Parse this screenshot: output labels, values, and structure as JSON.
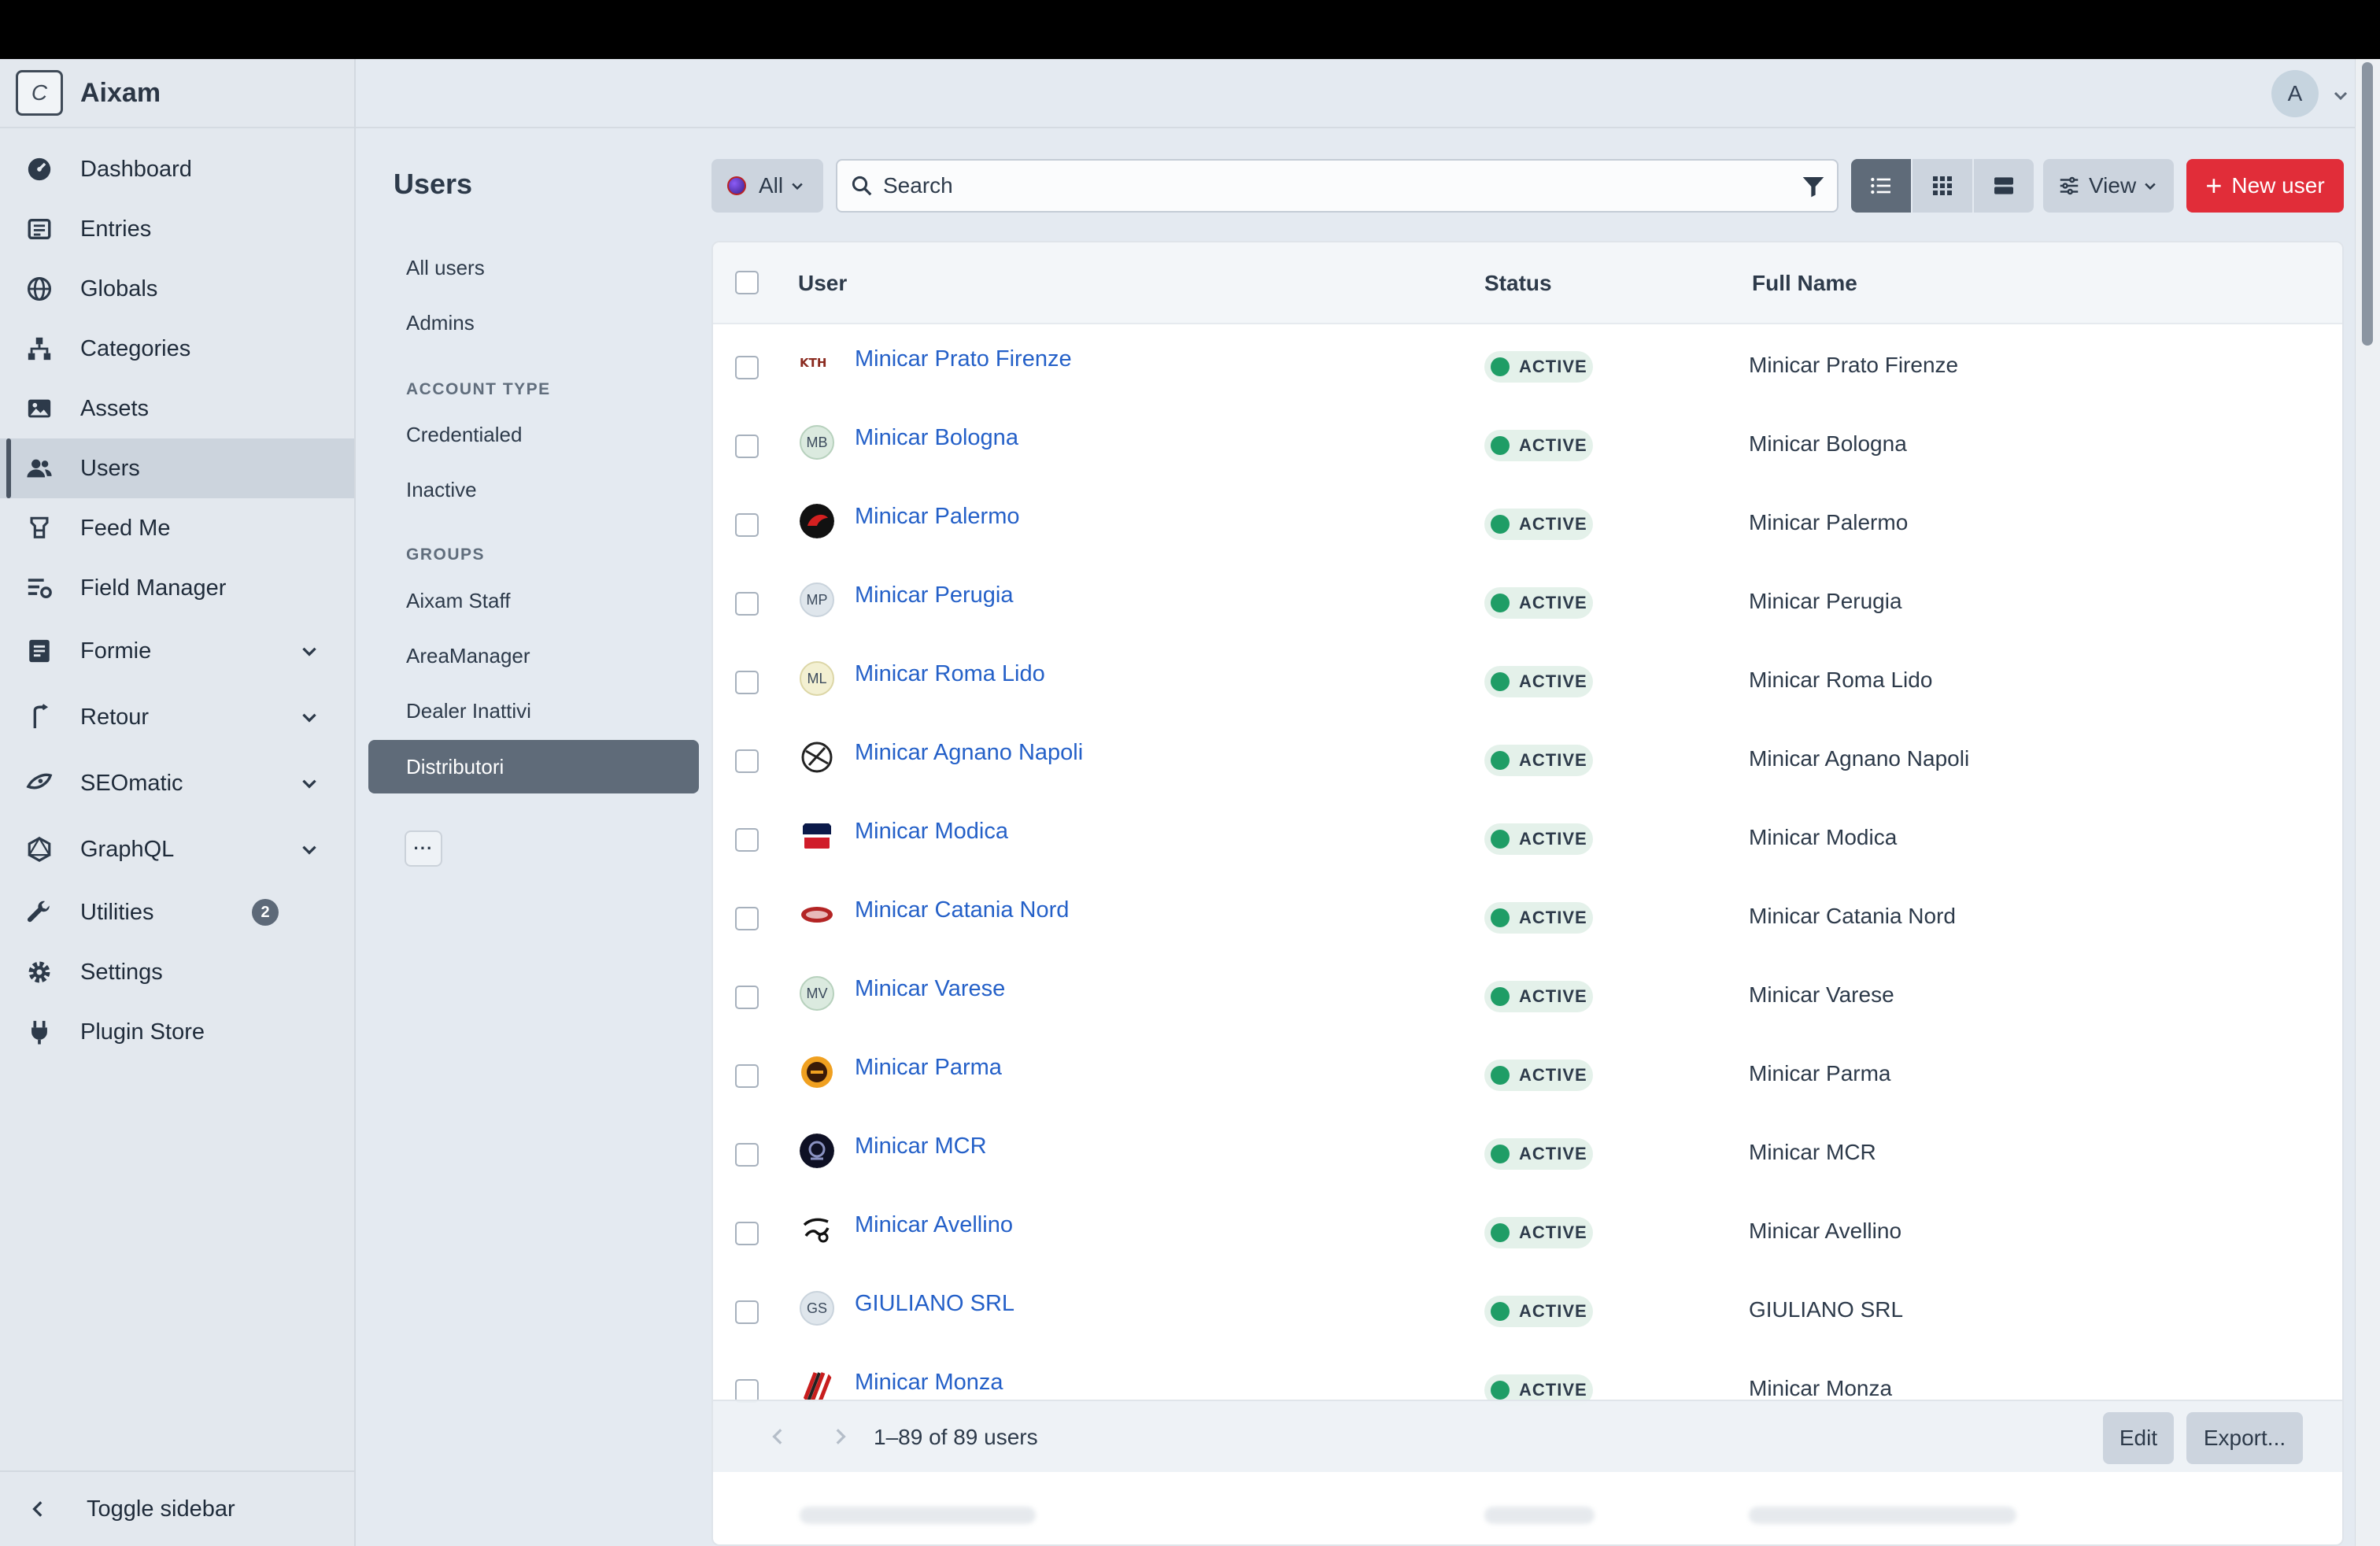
{
  "app": {
    "brand_initial": "C",
    "brand_name": "Aixam"
  },
  "colors": {
    "accent": "#e12d39",
    "link": "#2460c8",
    "status_active": "#1f9d66",
    "sidebar_bg": "#e3e8ee"
  },
  "sidebar": {
    "items": [
      {
        "label": "Dashboard",
        "icon": "gauge-icon"
      },
      {
        "label": "Entries",
        "icon": "newspaper-icon"
      },
      {
        "label": "Globals",
        "icon": "globe-icon"
      },
      {
        "label": "Categories",
        "icon": "sitemap-icon"
      },
      {
        "label": "Assets",
        "icon": "image-icon"
      },
      {
        "label": "Users",
        "icon": "users-icon",
        "active": true
      },
      {
        "label": "Feed Me",
        "icon": "feed-icon"
      },
      {
        "label": "Field Manager",
        "icon": "field-manager-icon"
      },
      {
        "label": "Formie",
        "icon": "form-icon"
      },
      {
        "label": "Retour",
        "icon": "retour-icon"
      },
      {
        "label": "SEOmatic",
        "icon": "seomatic-icon"
      },
      {
        "label": "GraphQL",
        "icon": "graphql-icon"
      },
      {
        "label": "Utilities",
        "icon": "wrench-icon",
        "badge": "2"
      },
      {
        "label": "Settings",
        "icon": "gear-icon"
      },
      {
        "label": "Plugin Store",
        "icon": "plug-icon"
      }
    ],
    "toggle_label": "Toggle sidebar"
  },
  "header": {
    "avatar_initial": "A"
  },
  "subnav": {
    "title": "Users",
    "all_users": "All users",
    "admins": "Admins",
    "account_type_heading": "ACCOUNT TYPE",
    "credentialed": "Credentialed",
    "inactive": "Inactive",
    "groups_heading": "GROUPS",
    "groups": [
      "Aixam Staff",
      "AreaManager",
      "Dealer Inattivi",
      "Distributori"
    ],
    "more_label": "···"
  },
  "toolbar": {
    "site_label": "All",
    "search_placeholder": "Search",
    "view_label": "View",
    "new_label": "New user"
  },
  "table": {
    "columns": {
      "user": "User",
      "status": "Status",
      "full_name": "Full Name"
    },
    "rows": [
      {
        "user": "Minicar Prato Firenze",
        "status": "ACTIVE",
        "full_name": "Minicar Prato Firenze",
        "icon": "kth-logo-icon",
        "initials": ""
      },
      {
        "user": "Minicar Bologna",
        "status": "ACTIVE",
        "full_name": "Minicar Bologna",
        "icon": "initials-icon",
        "initials": "MB"
      },
      {
        "user": "Minicar Palermo",
        "status": "ACTIVE",
        "full_name": "Minicar Palermo",
        "icon": "red-logo-icon",
        "initials": ""
      },
      {
        "user": "Minicar Perugia",
        "status": "ACTIVE",
        "full_name": "Minicar Perugia",
        "icon": "initials-icon",
        "initials": "MP"
      },
      {
        "user": "Minicar Roma Lido",
        "status": "ACTIVE",
        "full_name": "Minicar Roma Lido",
        "icon": "initials-icon",
        "initials": "ML"
      },
      {
        "user": "Minicar Agnano Napoli",
        "status": "ACTIVE",
        "full_name": "Minicar Agnano Napoli",
        "icon": "sketch-logo-icon",
        "initials": ""
      },
      {
        "user": "Minicar Modica",
        "status": "ACTIVE",
        "full_name": "Minicar Modica",
        "icon": "text-logo-icon",
        "initials": ""
      },
      {
        "user": "Minicar Catania Nord",
        "status": "ACTIVE",
        "full_name": "Minicar Catania Nord",
        "icon": "banner-logo-icon",
        "initials": ""
      },
      {
        "user": "Minicar Varese",
        "status": "ACTIVE",
        "full_name": "Minicar Varese",
        "icon": "initials-icon",
        "initials": "MV"
      },
      {
        "user": "Minicar Parma",
        "status": "ACTIVE",
        "full_name": "Minicar Parma",
        "icon": "badge-logo-icon",
        "initials": ""
      },
      {
        "user": "Minicar MCR",
        "status": "ACTIVE",
        "full_name": "Minicar MCR",
        "icon": "round-logo-icon",
        "initials": ""
      },
      {
        "user": "Minicar Avellino",
        "status": "ACTIVE",
        "full_name": "Minicar Avellino",
        "icon": "script-logo-icon",
        "initials": ""
      },
      {
        "user": "GIULIANO SRL",
        "status": "ACTIVE",
        "full_name": "GIULIANO SRL",
        "icon": "initials-icon",
        "initials": "GS"
      },
      {
        "user": "Minicar Monza",
        "status": "ACTIVE",
        "full_name": "Minicar Monza",
        "icon": "stripe-logo-icon",
        "initials": ""
      }
    ]
  },
  "footer": {
    "pagination": "1–89 of 89 users",
    "edit_label": "Edit",
    "export_label": "Export..."
  }
}
